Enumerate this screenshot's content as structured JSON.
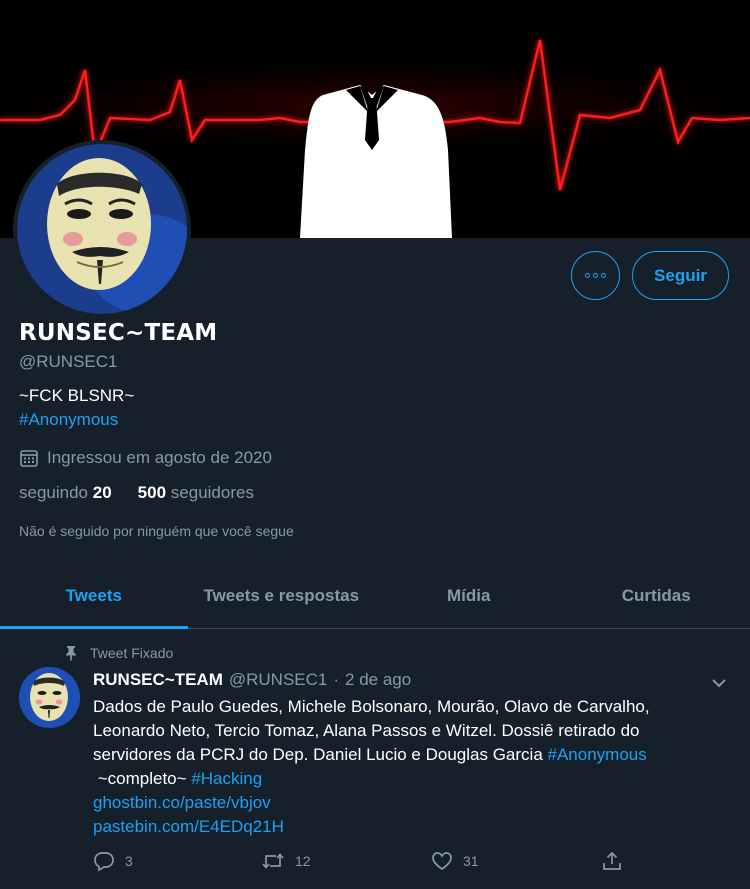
{
  "profile": {
    "name": "RUNSEC~TEAM",
    "handle": "@RUNSEC1",
    "bio": "~FCK BLSNR~",
    "bio_hashtag": "#Anonymous",
    "joined": "Ingressou em agosto de 2020",
    "following_label": "seguindo",
    "following_count": "20",
    "followers_count": "500",
    "followers_label": "seguidores",
    "not_followed": "Não é seguido por ninguém que você segue"
  },
  "actions": {
    "follow_label": "Seguir",
    "more_icon": "more-dots-icon"
  },
  "tabs": [
    {
      "label": "Tweets",
      "active": true
    },
    {
      "label": "Tweets e respostas",
      "active": false
    },
    {
      "label": "Mídia",
      "active": false
    },
    {
      "label": "Curtidas",
      "active": false
    }
  ],
  "tweet": {
    "pinned_label": "Tweet Fixado",
    "author_name": "RUNSEC~TEAM",
    "author_handle": "@RUNSEC1",
    "separator": "·",
    "date": "2 de ago",
    "text_line1": "Dados de Paulo Guedes, Michele Bolsonaro, Mourão, Olavo de Carvalho,",
    "text_line2": "Leonardo Neto, Tercio Tomaz, Alana Passos e Witzel. Dossiê retirado do",
    "text_line3": "servidores da PCRJ do Dep. Daniel Lucio e Douglas Garcia",
    "hashtag1": "#Anonymous",
    "text_line4": "~completo~",
    "hashtag2": "#Hacking",
    "link1": "ghostbin.co/paste/vbjov",
    "link2": "pastebin.com/E4EDq21H",
    "replies": "3",
    "retweets": "12",
    "likes": "31"
  },
  "colors": {
    "background": "#15202b",
    "accent": "#1da1f2",
    "muted": "#8899a6",
    "border": "#38444d"
  }
}
